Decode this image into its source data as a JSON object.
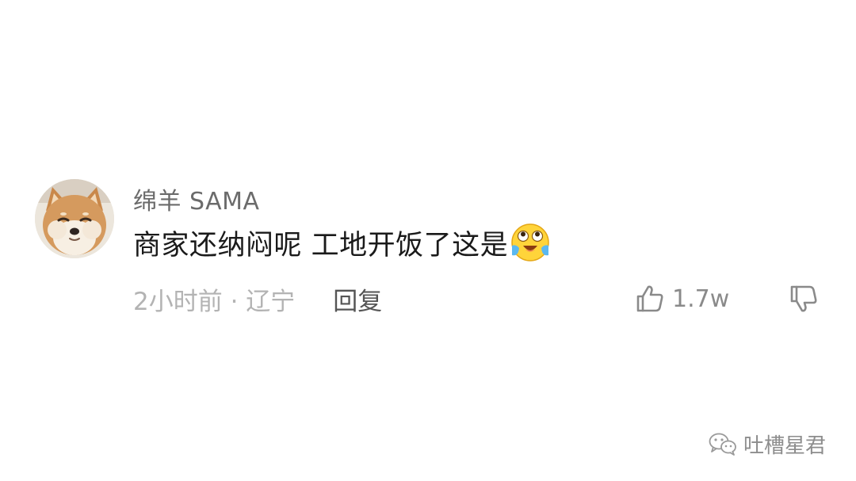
{
  "comment": {
    "avatar_icon": "shiba-dog-avatar-icon",
    "username": "绵羊 SAMA",
    "text": "商家还纳闷呢 工地开饭了这是",
    "emoji_icon": "tears-of-joy-emoji-icon",
    "time_location": "2小时前 · 辽宁",
    "reply_label": "回复",
    "like_icon": "thumbs-up-icon",
    "like_count": "1.7w",
    "dislike_icon": "thumbs-down-icon"
  },
  "watermark": {
    "icon": "wechat-icon",
    "text": "吐槽星君"
  },
  "colors": {
    "background": "#ffffff",
    "username": "#6b6b6b",
    "comment_text": "#1a1a1a",
    "meta_text": "#b3b3b3",
    "reply": "#555555",
    "like_count": "#8a8a8a"
  }
}
